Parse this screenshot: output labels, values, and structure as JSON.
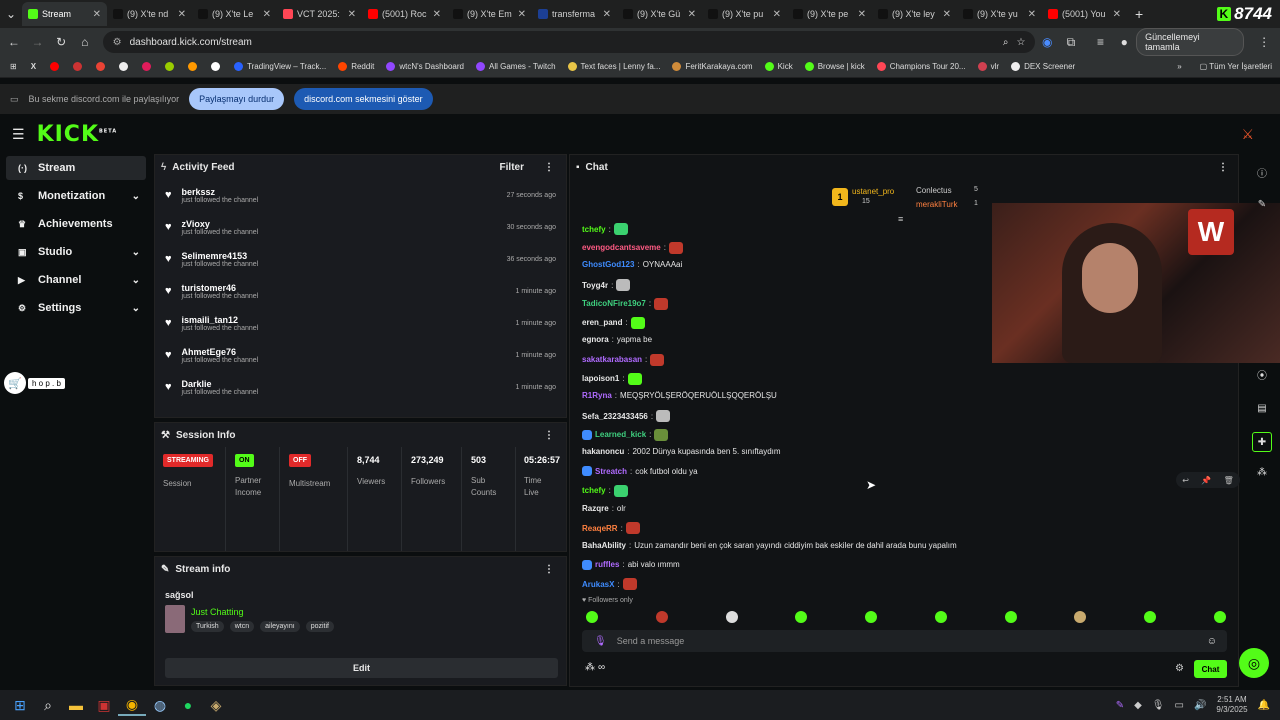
{
  "browser": {
    "tabs": [
      {
        "title": "Stream",
        "color": "#53fc18",
        "active": true
      },
      {
        "title": "(9) X'te nd",
        "color": "#111"
      },
      {
        "title": "(9) X'te Le",
        "color": "#111"
      },
      {
        "title": "VCT 2025:",
        "color": "#ff4655"
      },
      {
        "title": "(5001) Roc",
        "color": "#ff0000"
      },
      {
        "title": "(9) X'te Em",
        "color": "#111"
      },
      {
        "title": "transferma",
        "color": "#1c3f94"
      },
      {
        "title": "(9) X'te Gü",
        "color": "#111"
      },
      {
        "title": "(9) X'te pu",
        "color": "#111"
      },
      {
        "title": "(9) X'te pe",
        "color": "#111"
      },
      {
        "title": "(9) X'te ley",
        "color": "#111"
      },
      {
        "title": "(9) X'te yu",
        "color": "#111"
      },
      {
        "title": "(5001) You",
        "color": "#ff0000"
      }
    ],
    "new_tab": "+",
    "counter": "8744",
    "url": "dashboard.kick.com/stream",
    "update_button": "Güncellemeyi tamamla",
    "bookmarks": [
      {
        "label": "TradingView – Track...",
        "color": "#2962ff"
      },
      {
        "label": "Reddit",
        "color": "#ff4500"
      },
      {
        "label": "wtcN's Dashboard",
        "color": "#9147ff"
      },
      {
        "label": "All Games - Twitch",
        "color": "#9147ff"
      },
      {
        "label": "Text faces | Lenny fa...",
        "color": "#e8c547"
      },
      {
        "label": "FeritKarakaya.com",
        "color": "#d08c3a"
      },
      {
        "label": "Kick",
        "color": "#53fc18"
      },
      {
        "label": "Browse | kick",
        "color": "#53fc18"
      },
      {
        "label": "Champions Tour 20...",
        "color": "#ff4655"
      },
      {
        "label": "vlr",
        "color": "#d04050"
      },
      {
        "label": "DEX Screener",
        "color": "#eee"
      }
    ],
    "all_bookmarks": "Tüm Yer İşaretleri"
  },
  "share_bar": {
    "text": "Bu sekme discord.com ile paylaşılıyor",
    "stop": "Paylaşmayı durdur",
    "show": "discord.com sekmesini göster"
  },
  "kick": {
    "logo": "KICK",
    "beta": "BETA"
  },
  "sidebar": {
    "items": [
      {
        "label": "Stream"
      },
      {
        "label": "Monetization"
      },
      {
        "label": "Achievements"
      },
      {
        "label": "Studio"
      },
      {
        "label": "Channel"
      },
      {
        "label": "Settings"
      }
    ]
  },
  "hop_label": "h o p . b",
  "activity": {
    "title": "Activity Feed",
    "filter": "Filter",
    "items": [
      {
        "name": "berkssz",
        "sub": "just followed the channel",
        "time": "27 seconds ago"
      },
      {
        "name": "zVioxy",
        "sub": "just followed the channel",
        "time": "30 seconds ago"
      },
      {
        "name": "Selimemre4153",
        "sub": "just followed the channel",
        "time": "36 seconds ago"
      },
      {
        "name": "turistomer46",
        "sub": "just followed the channel",
        "time": "1 minute ago"
      },
      {
        "name": "ismaili_tan12",
        "sub": "just followed the channel",
        "time": "1 minute ago"
      },
      {
        "name": "AhmetEge76",
        "sub": "just followed the channel",
        "time": "1 minute ago"
      },
      {
        "name": "Darklie",
        "sub": "just followed the channel",
        "time": "1 minute ago"
      }
    ]
  },
  "session": {
    "title": "Session Info",
    "streaming": "STREAMING",
    "session": "Session",
    "on": "ON",
    "partner": "Partner Income",
    "off": "OFF",
    "multistream": "Multistream",
    "viewers_val": "8,744",
    "viewers": "Viewers",
    "followers_val": "273,249",
    "followers": "Followers",
    "subs_val": "503",
    "subs": "Sub Counts",
    "time_val": "05:26:57",
    "time": "Time Live"
  },
  "stream_info": {
    "title": "Stream info",
    "stream_title": "sağsol",
    "category": "Just Chatting",
    "tags": [
      "Turkish",
      "wtcn",
      "aileyayını",
      "pozitif"
    ],
    "edit": "Edit"
  },
  "chat": {
    "title": "Chat",
    "leader1": "ustanet_pro",
    "leader1_count": "15",
    "leader2": "Conlectus",
    "leader2_count": "5",
    "leader3": "merakliTurk",
    "leader3_count": "1",
    "messages": [
      {
        "user": "tchefy",
        "color": "#53fc18",
        "text": "",
        "emote": "#3bd16f"
      },
      {
        "user": "evengodcantsaveme",
        "color": "#ff5b84",
        "text": "",
        "emote": "#c0392b"
      },
      {
        "user": "GhostGod123",
        "color": "#3f8cff",
        "text": "OYNAAAai"
      },
      {
        "user": "Toyg4r",
        "color": "#e8e8e8",
        "text": "",
        "emote": "#bbb"
      },
      {
        "user": "TadicoNFire19o7",
        "color": "#3fd07f",
        "text": "",
        "emote": "#c0392b"
      },
      {
        "user": "eren_pand",
        "color": "#e8e8e8",
        "text": "",
        "emote": "#53fc18"
      },
      {
        "user": "egnora",
        "color": "#e8e8e8",
        "text": "yapma be"
      },
      {
        "user": "sakatkarabasan",
        "color": "#b06bff",
        "text": "",
        "emote": "#c0392b"
      },
      {
        "user": "lapoison1",
        "color": "#e8e8e8",
        "text": "",
        "emote": "#53fc18"
      },
      {
        "user": "R1Ryna",
        "color": "#b06bff",
        "text": "MEQŞRYÖLŞERÖQERUÖLLŞQQERÖLŞU"
      },
      {
        "user": "Sefa_2323433456",
        "color": "#e8e8e8",
        "text": "",
        "emote": "#bbb"
      },
      {
        "user": "Learned_kick",
        "color": "#3fd07f",
        "text": "",
        "emote": "#6a8f3a"
      },
      {
        "user": "hakanoncu",
        "color": "#e8e8e8",
        "text": "2002 Dünya kupasında ben 5. sınıftaydım"
      },
      {
        "user": "Streatch",
        "color": "#b06bff",
        "text": "cok futbol oldu ya"
      },
      {
        "user": "tchefy",
        "color": "#53fc18",
        "text": "",
        "emote": "#3bd16f"
      },
      {
        "user": "Razqre",
        "color": "#e8e8e8",
        "text": "olr"
      },
      {
        "user": "ReaqeRR",
        "color": "#ff8040",
        "text": "",
        "emote": "#c0392b"
      },
      {
        "user": "BahaAbility",
        "color": "#e8e8e8",
        "text": "Uzun zamandır beni en çok saran yayındı ciddiyim bak eskiler de dahil arada bunu yapalım"
      },
      {
        "user": "ruffles",
        "color": "#b06bff",
        "text": "abi valo ımmm"
      },
      {
        "user": "ArukasX",
        "color": "#3f8cff",
        "text": "",
        "emote": "#c0392b"
      }
    ],
    "followers_only": "Followers only",
    "placeholder": "Send a message",
    "send": "Chat",
    "infinity": "∞"
  },
  "taskbar": {
    "time": "2:51 AM",
    "date": "9/3/2025"
  }
}
